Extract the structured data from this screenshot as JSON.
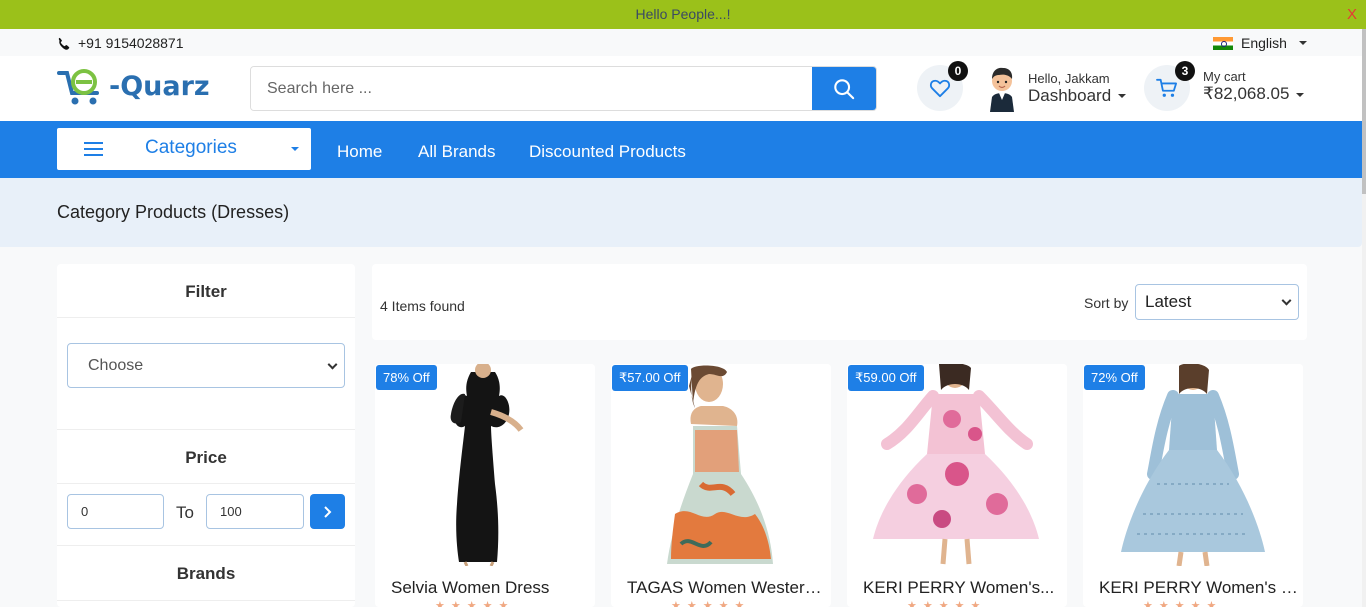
{
  "announcement": {
    "text": "Hello People...!",
    "close": "X"
  },
  "topbar": {
    "phone": "+91 9154028871",
    "language": "English"
  },
  "header": {
    "logo": "e-Quarz",
    "search_placeholder": "Search here ...",
    "wishlist_count": "0",
    "user_greeting": "Hello, Jakkam",
    "user_menu": "Dashboard",
    "cart_count": "3",
    "cart_label": "My cart",
    "cart_total": "₹82,068.05"
  },
  "nav": {
    "categories": "Categories",
    "links": [
      "Home",
      "All Brands",
      "Discounted Products"
    ]
  },
  "page_title": "Category Products (Dresses)",
  "sidebar": {
    "filter_title": "Filter",
    "filter_select": "Choose",
    "price_title": "Price",
    "price_min": "0",
    "price_to": "To",
    "price_max": "100",
    "brands_title": "Brands"
  },
  "results": {
    "count": "4 Items found",
    "sort_label": "Sort by",
    "sort_value": "Latest"
  },
  "products": [
    {
      "tag": "78% Off",
      "name": "Selvia Women Dress"
    },
    {
      "tag": "₹57.00 Off",
      "name": "TAGAS Women Western..."
    },
    {
      "tag": "₹59.00 Off",
      "name": "KERI PERRY Women's..."
    },
    {
      "tag": "72% Off",
      "name": "KERI PERRY Women's Chif..."
    }
  ],
  "colors": {
    "primary": "#1e7fe6",
    "announce": "#9bc11a",
    "banner": "#e8f0f9"
  },
  "icons": [
    "phone-icon",
    "india-flag-icon",
    "search-icon",
    "heart-icon",
    "user-avatar",
    "cart-icon",
    "hamburger-icon",
    "chevron-right-icon"
  ]
}
